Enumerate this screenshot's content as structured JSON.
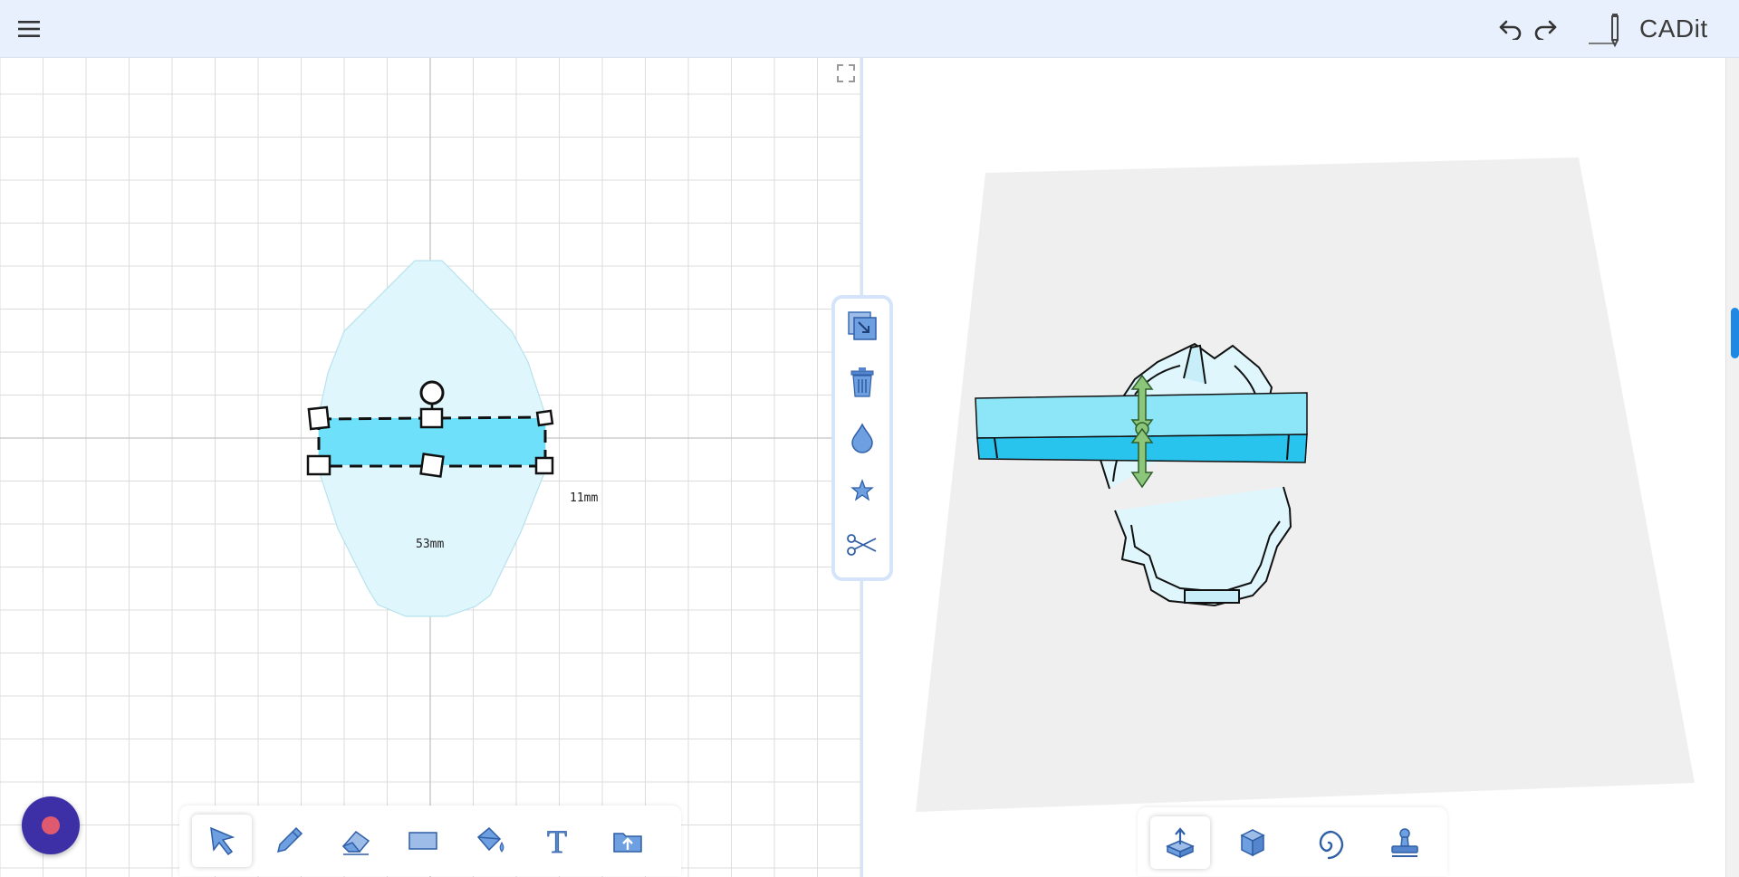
{
  "app": {
    "title": "CADit",
    "accent_color": "#1e88e5"
  },
  "header": {
    "menu_icon": "hamburger-menu-icon",
    "undo_icon": "undo-icon",
    "redo_icon": "redo-icon",
    "logo_icon": "pencil-logo-icon"
  },
  "sketch": {
    "width_label": "53mm",
    "height_label": "11mm",
    "fill_color": "#6ee0fa",
    "base_shape_color": "#dff6fc"
  },
  "view_controls": {
    "fullscreen_left_icon": "fullscreen-icon",
    "fullscreen_right_icon": "fullscreen-icon"
  },
  "side_toolbar": {
    "items": [
      {
        "name": "duplicate",
        "icon": "duplicate-icon"
      },
      {
        "name": "delete",
        "icon": "trash-icon"
      },
      {
        "name": "color",
        "icon": "droplet-icon"
      },
      {
        "name": "favorite",
        "icon": "star-icon"
      },
      {
        "name": "cut",
        "icon": "scissors-icon"
      }
    ]
  },
  "draw_toolbar": {
    "active": "select",
    "items": [
      {
        "name": "select",
        "icon": "cursor-arrow-icon"
      },
      {
        "name": "pencil",
        "icon": "pencil-icon"
      },
      {
        "name": "eraser",
        "icon": "eraser-icon"
      },
      {
        "name": "rectangle",
        "icon": "rectangle-icon"
      },
      {
        "name": "paint-bucket",
        "icon": "paint-bucket-icon"
      },
      {
        "name": "text",
        "icon": "text-icon",
        "glyph": "T"
      },
      {
        "name": "import",
        "icon": "folder-upload-icon"
      }
    ]
  },
  "model_toolbar": {
    "active": "extrude",
    "items": [
      {
        "name": "extrude",
        "icon": "extrude-icon"
      },
      {
        "name": "solid",
        "icon": "cube-icon"
      },
      {
        "name": "spiral",
        "icon": "spiral-icon"
      },
      {
        "name": "stamp",
        "icon": "stamp-icon"
      }
    ]
  },
  "record_button": {
    "icon": "record-icon",
    "color": "#3d2fa6"
  }
}
